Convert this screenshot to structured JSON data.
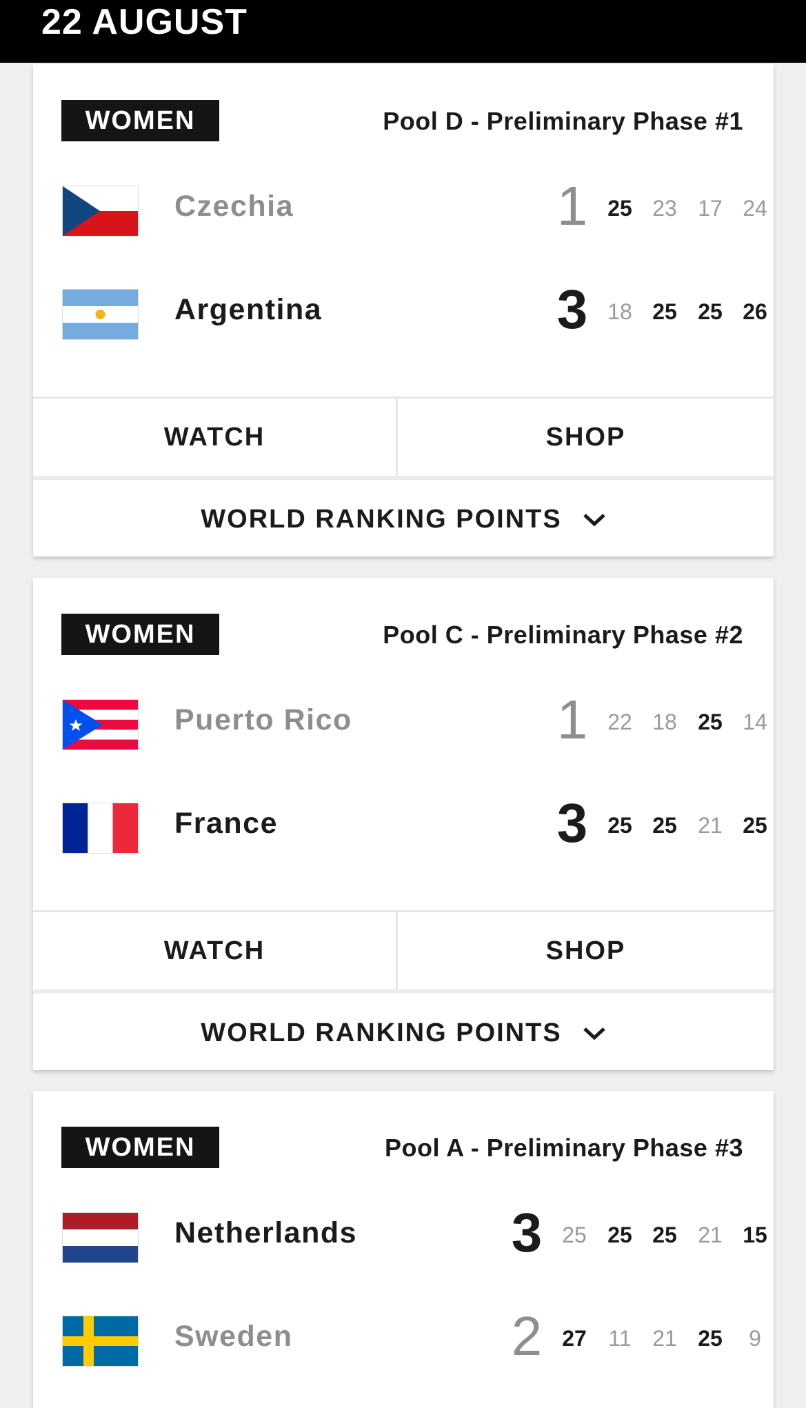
{
  "header": {
    "date": "22 AUGUST"
  },
  "matches": [
    {
      "category": "WOMEN",
      "pool": "Pool D - Preliminary Phase #1",
      "teams": [
        {
          "name": "Czechia",
          "flag": "czechia-flag",
          "sets_won": "1",
          "result": "loser",
          "scores": [
            {
              "v": "25",
              "win": true
            },
            {
              "v": "23",
              "win": false
            },
            {
              "v": "17",
              "win": false
            },
            {
              "v": "24",
              "win": false
            }
          ]
        },
        {
          "name": "Argentina",
          "flag": "argentina-flag",
          "sets_won": "3",
          "result": "winner",
          "scores": [
            {
              "v": "18",
              "win": false
            },
            {
              "v": "25",
              "win": true
            },
            {
              "v": "25",
              "win": true
            },
            {
              "v": "26",
              "win": true
            }
          ]
        }
      ],
      "watch_label": "WATCH",
      "shop_label": "SHOP",
      "ranking_label": "WORLD RANKING POINTS"
    },
    {
      "category": "WOMEN",
      "pool": "Pool C - Preliminary Phase #2",
      "teams": [
        {
          "name": "Puerto Rico",
          "flag": "puerto-rico-flag",
          "sets_won": "1",
          "result": "loser",
          "scores": [
            {
              "v": "22",
              "win": false
            },
            {
              "v": "18",
              "win": false
            },
            {
              "v": "25",
              "win": true
            },
            {
              "v": "14",
              "win": false
            }
          ]
        },
        {
          "name": "France",
          "flag": "france-flag",
          "sets_won": "3",
          "result": "winner",
          "scores": [
            {
              "v": "25",
              "win": true
            },
            {
              "v": "25",
              "win": true
            },
            {
              "v": "21",
              "win": false
            },
            {
              "v": "25",
              "win": true
            }
          ]
        }
      ],
      "watch_label": "WATCH",
      "shop_label": "SHOP",
      "ranking_label": "WORLD RANKING POINTS"
    },
    {
      "category": "WOMEN",
      "pool": "Pool A - Preliminary Phase #3",
      "teams": [
        {
          "name": "Netherlands",
          "flag": "netherlands-flag",
          "sets_won": "3",
          "result": "winner",
          "scores": [
            {
              "v": "25",
              "win": false
            },
            {
              "v": "25",
              "win": true
            },
            {
              "v": "25",
              "win": true
            },
            {
              "v": "21",
              "win": false
            },
            {
              "v": "15",
              "win": true
            }
          ]
        },
        {
          "name": "Sweden",
          "flag": "sweden-flag",
          "sets_won": "2",
          "result": "loser",
          "scores": [
            {
              "v": "27",
              "win": true
            },
            {
              "v": "11",
              "win": false
            },
            {
              "v": "21",
              "win": false
            },
            {
              "v": "25",
              "win": true
            },
            {
              "v": "9",
              "win": false
            }
          ]
        }
      ]
    }
  ]
}
